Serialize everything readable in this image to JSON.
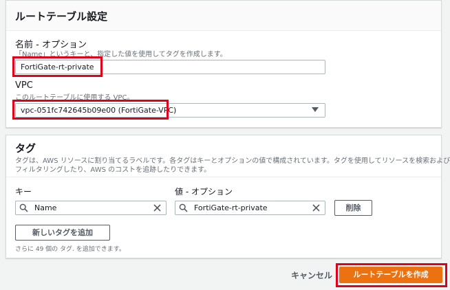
{
  "route_table_settings": {
    "title": "ルートテーブル設定",
    "name": {
      "label": "名前 - オプション",
      "description": "「Name」というキーと、指定した値を使用してタグを作成します。",
      "value": "FortiGate-rt-private"
    },
    "vpc": {
      "label": "VPC",
      "description": "このルートテーブルに使用する VPC。",
      "selected": "vpc-051fc742645b09e00 (FortiGate-VPC)"
    }
  },
  "tags": {
    "title": "タグ",
    "description_line1": "タグは、AWS リソースに割り当てるラベルです。各タグはキーとオプションの値で構成されています。タグを使用してリソースを検索および",
    "description_line2": "フィルタリングしたり、AWS のコストを追跡したりできます。",
    "key_header": "キー",
    "value_header": "値 - オプション",
    "rows": [
      {
        "key": "Name",
        "value": "FortiGate-rt-private",
        "remove_label": "削除"
      }
    ],
    "add_button_label": "新しいタグを追加",
    "limit_text": "さらに 49 個の タグ. を追加できます。"
  },
  "footer": {
    "cancel_label": "キャンセル",
    "create_label": "ルートテーブルを作成"
  },
  "colors": {
    "primary_button": "#ec7211",
    "highlight_border": "#e0001a",
    "page_background": "#f2f3f3"
  }
}
